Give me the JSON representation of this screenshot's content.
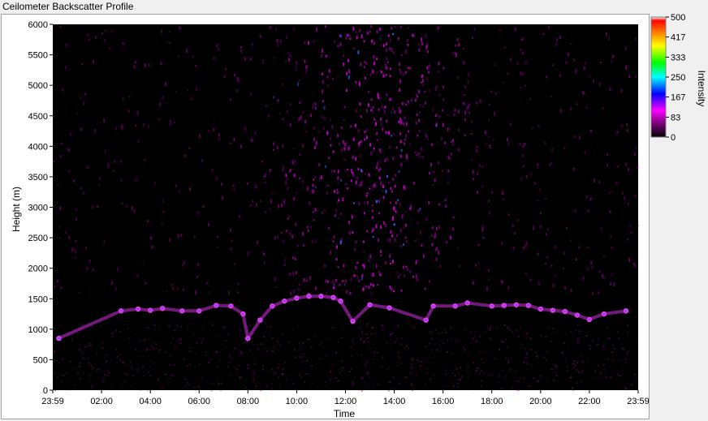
{
  "window": {
    "title": "Ceilometer Backscatter Profile"
  },
  "chart_data": {
    "type": "heatmap",
    "title": "Ceilometer Backscatter Profile",
    "xlabel": "Time",
    "ylabel": "Height (m)",
    "xticks": [
      "23:59",
      "02:00",
      "04:00",
      "06:00",
      "08:00",
      "10:00",
      "12:00",
      "14:00",
      "16:00",
      "18:00",
      "20:00",
      "22:00",
      "23:59"
    ],
    "xlim_hours": [
      0,
      24
    ],
    "ylim": [
      0,
      6000
    ],
    "yticks": [
      0,
      500,
      1000,
      1500,
      2000,
      2500,
      3000,
      3500,
      4000,
      4500,
      5000,
      5500,
      6000
    ],
    "colorbar": {
      "label": "Intensity",
      "ticks": [
        0,
        83,
        167,
        250,
        333,
        417,
        500
      ],
      "tick_labels": [
        "0",
        "83",
        "167",
        "250",
        "333",
        "417",
        "500"
      ],
      "range": [
        0,
        500
      ],
      "colors": [
        "#000000",
        "#ff00ff",
        "#0000ff",
        "#00ffff",
        "#00ff00",
        "#ffff00",
        "#ff8000",
        "#ff0000",
        "#ffffff"
      ]
    },
    "grid": false,
    "cloud_layer": [
      {
        "t": 0.25,
        "h": 850
      },
      {
        "t": 2.8,
        "h": 1300
      },
      {
        "t": 3.5,
        "h": 1330
      },
      {
        "t": 4.0,
        "h": 1310
      },
      {
        "t": 4.5,
        "h": 1340
      },
      {
        "t": 5.3,
        "h": 1300
      },
      {
        "t": 6.0,
        "h": 1300
      },
      {
        "t": 6.7,
        "h": 1390
      },
      {
        "t": 7.3,
        "h": 1380
      },
      {
        "t": 7.8,
        "h": 1250
      },
      {
        "t": 8.0,
        "h": 850
      },
      {
        "t": 8.5,
        "h": 1150
      },
      {
        "t": 9.0,
        "h": 1380
      },
      {
        "t": 9.5,
        "h": 1460
      },
      {
        "t": 10.0,
        "h": 1510
      },
      {
        "t": 10.5,
        "h": 1540
      },
      {
        "t": 11.0,
        "h": 1540
      },
      {
        "t": 11.5,
        "h": 1520
      },
      {
        "t": 11.8,
        "h": 1460
      },
      {
        "t": 12.3,
        "h": 1130
      },
      {
        "t": 13.0,
        "h": 1400
      },
      {
        "t": 13.8,
        "h": 1350
      },
      {
        "t": 15.3,
        "h": 1150
      },
      {
        "t": 15.6,
        "h": 1380
      },
      {
        "t": 16.5,
        "h": 1380
      },
      {
        "t": 17.0,
        "h": 1430
      },
      {
        "t": 18.0,
        "h": 1380
      },
      {
        "t": 18.5,
        "h": 1390
      },
      {
        "t": 19.0,
        "h": 1400
      },
      {
        "t": 19.5,
        "h": 1390
      },
      {
        "t": 20.0,
        "h": 1330
      },
      {
        "t": 20.5,
        "h": 1310
      },
      {
        "t": 21.0,
        "h": 1290
      },
      {
        "t": 21.5,
        "h": 1230
      },
      {
        "t": 22.0,
        "h": 1160
      },
      {
        "t": 22.6,
        "h": 1250
      },
      {
        "t": 23.5,
        "h": 1300
      }
    ]
  }
}
